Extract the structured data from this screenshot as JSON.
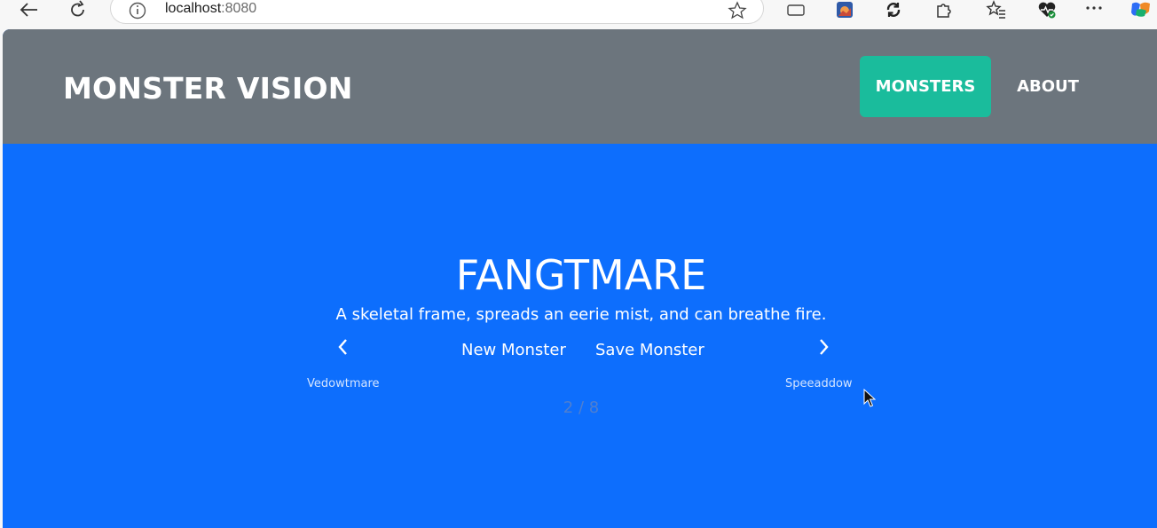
{
  "browser": {
    "url_host": "localhost",
    "url_port": ":8080",
    "icons": [
      "back-icon",
      "refresh-icon",
      "info-icon",
      "favorite-star-icon",
      "tab-icon",
      "extension-image-icon",
      "sync-icon",
      "extensions-puzzle-icon",
      "favorites-list-icon",
      "health-icon",
      "more-icon",
      "copilot-icon"
    ]
  },
  "nav": {
    "brand": "MONSTER VISION",
    "monsters_label": "MONSTERS",
    "about_label": "ABOUT"
  },
  "monster": {
    "name": "FANGTMARE",
    "description": "A skeletal frame, spreads an eerie mist, and can breathe fire.",
    "new_label": "New Monster",
    "save_label": "Save Monster",
    "prev_name": "Vedowtmare",
    "next_name": "Speeaddow",
    "counter": "2 / 8"
  },
  "colors": {
    "navbar": "#6c757d",
    "page_bg": "#0d6efd",
    "active_nav": "#1abc9c"
  }
}
